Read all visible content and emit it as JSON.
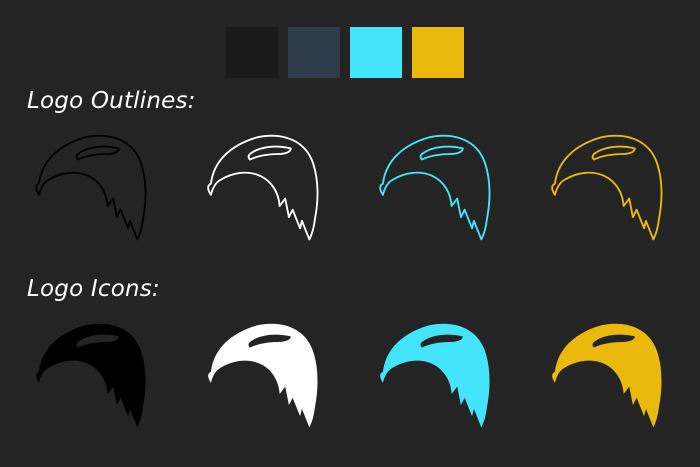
{
  "palette": {
    "swatches": [
      {
        "name": "near-black",
        "color": "#1a1a1a"
      },
      {
        "name": "slate",
        "color": "#2e3c4b"
      },
      {
        "name": "cyan",
        "color": "#44e5fc"
      },
      {
        "name": "gold",
        "color": "#eab90c"
      }
    ]
  },
  "sections": {
    "outlines": {
      "title": "Logo Outlines:",
      "items": [
        {
          "icon": "eagle-head-outline-icon",
          "color": "#000000"
        },
        {
          "icon": "eagle-head-outline-icon",
          "color": "#ffffff"
        },
        {
          "icon": "eagle-head-outline-icon",
          "color": "#44e5fc"
        },
        {
          "icon": "eagle-head-outline-icon",
          "color": "#eab90c"
        }
      ]
    },
    "icons": {
      "title": "Logo Icons:",
      "items": [
        {
          "icon": "eagle-head-icon",
          "color": "#000000"
        },
        {
          "icon": "eagle-head-icon",
          "color": "#ffffff"
        },
        {
          "icon": "eagle-head-icon",
          "color": "#44e5fc"
        },
        {
          "icon": "eagle-head-icon",
          "color": "#eab90c"
        }
      ]
    }
  }
}
